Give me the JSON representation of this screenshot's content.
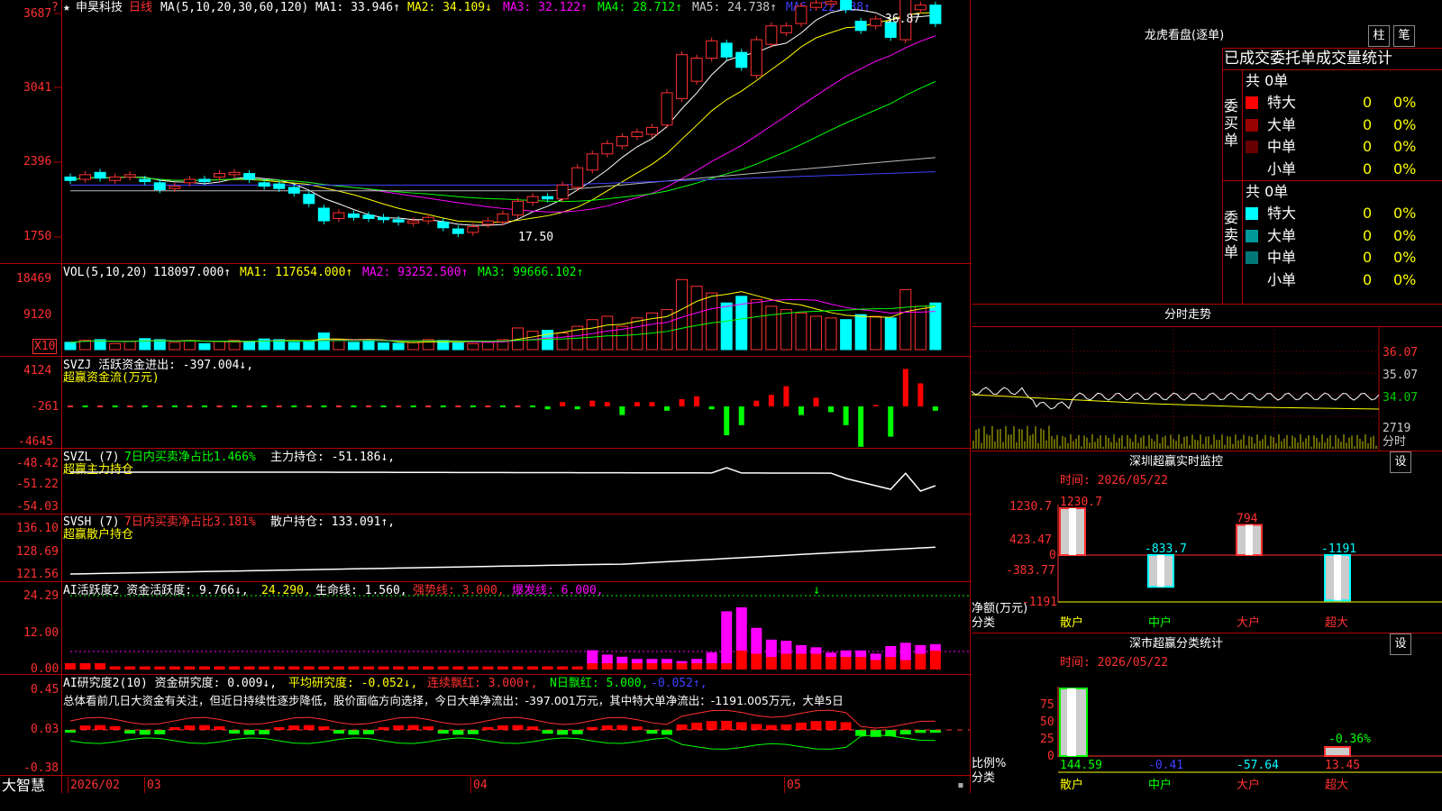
{
  "stock": {
    "name": "申昊科技",
    "period": "日线",
    "star": "★",
    "marker": "?"
  },
  "price_ma": {
    "label": "MA(5,10,20,30,60,120)",
    "items": [
      {
        "t": "MA1: 33.946↑",
        "c": "#ffffff"
      },
      {
        "t": "MA2: 34.109↓",
        "c": "#ffff00"
      },
      {
        "t": "MA3: 32.122↑",
        "c": "#ff00ff"
      },
      {
        "t": "MA4: 28.712↑",
        "c": "#00ff00"
      },
      {
        "t": "MA5: 24.738↑",
        "c": "#cccccc"
      },
      {
        "t": "MA6: 22.938↑",
        "c": "#4040ff"
      }
    ]
  },
  "price_axis": [
    "3687",
    "3041",
    "2396",
    "1750"
  ],
  "price_marks": {
    "high": "36.87",
    "low": "17.50"
  },
  "vol": {
    "label": "VOL(5,10,20)",
    "value": "118097.000↑",
    "items": [
      {
        "t": "MA1: 117654.000↑",
        "c": "#ffff00"
      },
      {
        "t": "MA2: 93252.500↑",
        "c": "#ff00ff"
      },
      {
        "t": "MA3: 99666.102↑",
        "c": "#00ff00"
      }
    ],
    "axis": [
      "18469",
      "9120"
    ],
    "unit": "X10"
  },
  "svzj": {
    "label": "SVZJ  活跃资金进出: -397.004↓,",
    "sub": "超赢资金流(万元)",
    "axis": [
      "4124",
      "-261",
      "-4645"
    ]
  },
  "svzl": {
    "label": "SVZL (7)",
    "p1": "7日内买卖净占比1.466%",
    "p2": "主力持仓: -51.186↓,",
    "sub": "超赢主力持仓",
    "axis": [
      "-48.42",
      "-51.22",
      "-54.03"
    ]
  },
  "svsh": {
    "label": "SVSH (7)",
    "p1": "7日内买卖净占比3.181%",
    "p2": "散户持仓: 133.091↑,",
    "sub": "超赢散户持仓",
    "axis": [
      "136.10",
      "128.69",
      "121.56"
    ]
  },
  "ai_act": {
    "label": "AI活跃度2 资金活跃度: 9.766↓,",
    "v2": "24.290,",
    "v3": "生命线: 1.560,",
    "v4": "强势线: 3.000,",
    "v5": "爆发线: 6.000,",
    "axis": [
      "24.29",
      "12.00",
      "0.00"
    ]
  },
  "ai_res": {
    "label": "AI研究度2(10) 资金研究度: 0.009↓,",
    "v2": "平均研究度: -0.052↓,",
    "v3": "连续飘红: 3.000↑,",
    "v4": "N日飘红: 5.000,",
    "v5": "-0.052↑,",
    "summary": "总体看前几日大资金有关注，但近日持续性逐步降低，股价面临方向选择，今日大单净流出：-397.001万元，其中特大单净流出：-1191.005万元，大单5日",
    "axis": [
      "0.45",
      "0.03",
      "-0.38"
    ]
  },
  "bottom": {
    "brand": "大智慧",
    "dates": [
      "2026/02",
      "03",
      "04",
      "05"
    ]
  },
  "dragon": {
    "title": "龙虎看盘(逐单)",
    "btn1": "柱",
    "btn2": "笔",
    "header": "已成交委托单成交量统计",
    "buy": {
      "side": "委买单",
      "count": "共 0单",
      "rows": [
        {
          "n": "特大",
          "v": "0",
          "p": "0%",
          "c": "#ff0000"
        },
        {
          "n": "大单",
          "v": "0",
          "p": "0%",
          "c": "#990000"
        },
        {
          "n": "中单",
          "v": "0",
          "p": "0%",
          "c": "#660000"
        },
        {
          "n": "小单",
          "v": "0",
          "p": "0%",
          "c": ""
        }
      ]
    },
    "sell": {
      "side": "委卖单",
      "count": "共 0单",
      "rows": [
        {
          "n": "特大",
          "v": "0",
          "p": "0%",
          "c": "#00ffff"
        },
        {
          "n": "大单",
          "v": "0",
          "p": "0%",
          "c": "#009999"
        },
        {
          "n": "中单",
          "v": "0",
          "p": "0%",
          "c": "#007777"
        },
        {
          "n": "小单",
          "v": "0",
          "p": "0%",
          "c": ""
        }
      ]
    }
  },
  "minute": {
    "title": "分时走势",
    "axis": [
      "36.07",
      "35.07",
      "34.07"
    ],
    "vol": "2719",
    "vol_unit": "分时"
  },
  "monitor": {
    "title": "深圳超赢实时监控",
    "btn": "设",
    "time": "时间: 2026/05/22",
    "axis": [
      "1230.7",
      "423.47",
      "0",
      "-383.77",
      "-1191"
    ],
    "ylabel": "净额(万元)",
    "xlabel": "分类",
    "bars": [
      {
        "cat": "散户",
        "val": "1230.7"
      },
      {
        "cat": "中户",
        "val": "-833.7"
      },
      {
        "cat": "大户",
        "val": "794"
      },
      {
        "cat": "超大",
        "val": "-1191"
      }
    ]
  },
  "classify": {
    "title": "深市超赢分类统计",
    "btn": "设",
    "time": "时间: 2026/05/22",
    "axis": [
      "75",
      "50",
      "25",
      "0"
    ],
    "ylabel": "比例%",
    "xlabel": "分类",
    "cats": [
      "散户",
      "中户",
      "大户",
      "超大"
    ],
    "vals": [
      "144.59",
      "-0.41",
      "-57.64",
      "13.45"
    ],
    "mark": "-0.36%"
  },
  "chart_data": {
    "type": "candlestick",
    "candles": [
      [
        2.27,
        2.24
      ],
      [
        2.25,
        2.29
      ],
      [
        2.31,
        2.26
      ],
      [
        2.24,
        2.27
      ],
      [
        2.27,
        2.29
      ],
      [
        2.25,
        2.23
      ],
      [
        2.22,
        2.16
      ],
      [
        2.17,
        2.19
      ],
      [
        2.22,
        2.25
      ],
      [
        2.25,
        2.23
      ],
      [
        2.27,
        2.3
      ],
      [
        2.29,
        2.31
      ],
      [
        2.3,
        2.25
      ],
      [
        2.22,
        2.19
      ],
      [
        2.21,
        2.17
      ],
      [
        2.18,
        2.13
      ],
      [
        2.12,
        2.04
      ],
      [
        2.0,
        1.89
      ],
      [
        1.91,
        1.96
      ],
      [
        1.95,
        1.92
      ],
      [
        1.94,
        1.91
      ],
      [
        1.92,
        1.9
      ],
      [
        1.9,
        1.88
      ],
      [
        1.87,
        1.89
      ],
      [
        1.89,
        1.92
      ],
      [
        1.88,
        1.83
      ],
      [
        1.82,
        1.78
      ],
      [
        1.79,
        1.84
      ],
      [
        1.86,
        1.89
      ],
      [
        1.88,
        1.95
      ],
      [
        1.94,
        2.06
      ],
      [
        2.05,
        2.1
      ],
      [
        2.1,
        2.08
      ],
      [
        2.08,
        2.2
      ],
      [
        2.18,
        2.35
      ],
      [
        2.33,
        2.47
      ],
      [
        2.47,
        2.56
      ],
      [
        2.54,
        2.62
      ],
      [
        2.62,
        2.66
      ],
      [
        2.64,
        2.7
      ],
      [
        2.72,
        3.0
      ],
      [
        2.95,
        3.33
      ],
      [
        3.1,
        3.3
      ],
      [
        3.3,
        3.45
      ],
      [
        3.43,
        3.31
      ],
      [
        3.35,
        3.22
      ],
      [
        3.15,
        3.46
      ],
      [
        3.42,
        3.58
      ],
      [
        3.52,
        3.58
      ],
      [
        3.6,
        3.75
      ],
      [
        3.74,
        3.78
      ],
      [
        3.77,
        3.79
      ],
      [
        3.8,
        3.72
      ],
      [
        3.62,
        3.54
      ],
      [
        3.58,
        3.64
      ],
      [
        3.61,
        3.48
      ],
      [
        3.46,
        3.88
      ],
      [
        3.72,
        3.76
      ],
      [
        3.76,
        3.6
      ]
    ],
    "volume": [
      22,
      28,
      30,
      18,
      25,
      33,
      30,
      22,
      26,
      18,
      25,
      28,
      24,
      32,
      30,
      22,
      26,
      50,
      30,
      22,
      25,
      20,
      19,
      21,
      30,
      28,
      20,
      18,
      22,
      30,
      65,
      55,
      58,
      50,
      70,
      90,
      100,
      70,
      95,
      110,
      120,
      210,
      190,
      170,
      140,
      160,
      150,
      130,
      120,
      110,
      100,
      95,
      90,
      105,
      100,
      95,
      180,
      130,
      140
    ],
    "svzj": [
      0,
      0,
      0,
      0,
      0,
      0,
      0,
      0,
      0,
      0,
      0,
      0,
      0,
      0,
      0,
      0,
      0,
      0,
      0,
      0,
      0,
      0,
      0,
      0,
      0,
      0,
      0,
      0,
      0,
      0,
      0,
      0,
      -0.2,
      0.3,
      -0.2,
      0.4,
      0.3,
      -0.6,
      0.3,
      0.3,
      -0.3,
      0.5,
      0.7,
      -0.2,
      -2.0,
      -1.3,
      0.4,
      0.8,
      1.4,
      -0.6,
      0.6,
      -0.4,
      -1.3,
      -2.8,
      0.1,
      -2.1,
      2.6,
      1.6,
      -0.3
    ],
    "act": [
      2,
      2,
      2,
      1,
      1,
      1,
      1,
      1,
      1,
      1,
      1,
      1,
      1,
      1,
      1,
      1,
      1,
      1,
      1,
      1,
      1,
      1,
      1,
      1,
      1,
      1,
      1,
      1,
      1,
      1,
      1,
      1,
      1,
      1,
      1,
      2,
      2,
      2,
      2,
      2,
      2,
      2,
      2,
      2,
      2,
      6,
      5,
      4,
      5,
      5,
      5,
      4,
      4,
      4,
      3,
      4,
      3,
      5,
      6
    ],
    "act_top": [
      0,
      0,
      0,
      0,
      0,
      0,
      0,
      0,
      0,
      0,
      0,
      0,
      0,
      0,
      0,
      0,
      0,
      0,
      0,
      0,
      0,
      0,
      0,
      0,
      0,
      0,
      0,
      0,
      0,
      0,
      0,
      0,
      0,
      0,
      0,
      6,
      4,
      3,
      2,
      2,
      2,
      1,
      2,
      5,
      24,
      20,
      12,
      8,
      6,
      4,
      3,
      2,
      3,
      3,
      3,
      5,
      8,
      4,
      3
    ]
  }
}
